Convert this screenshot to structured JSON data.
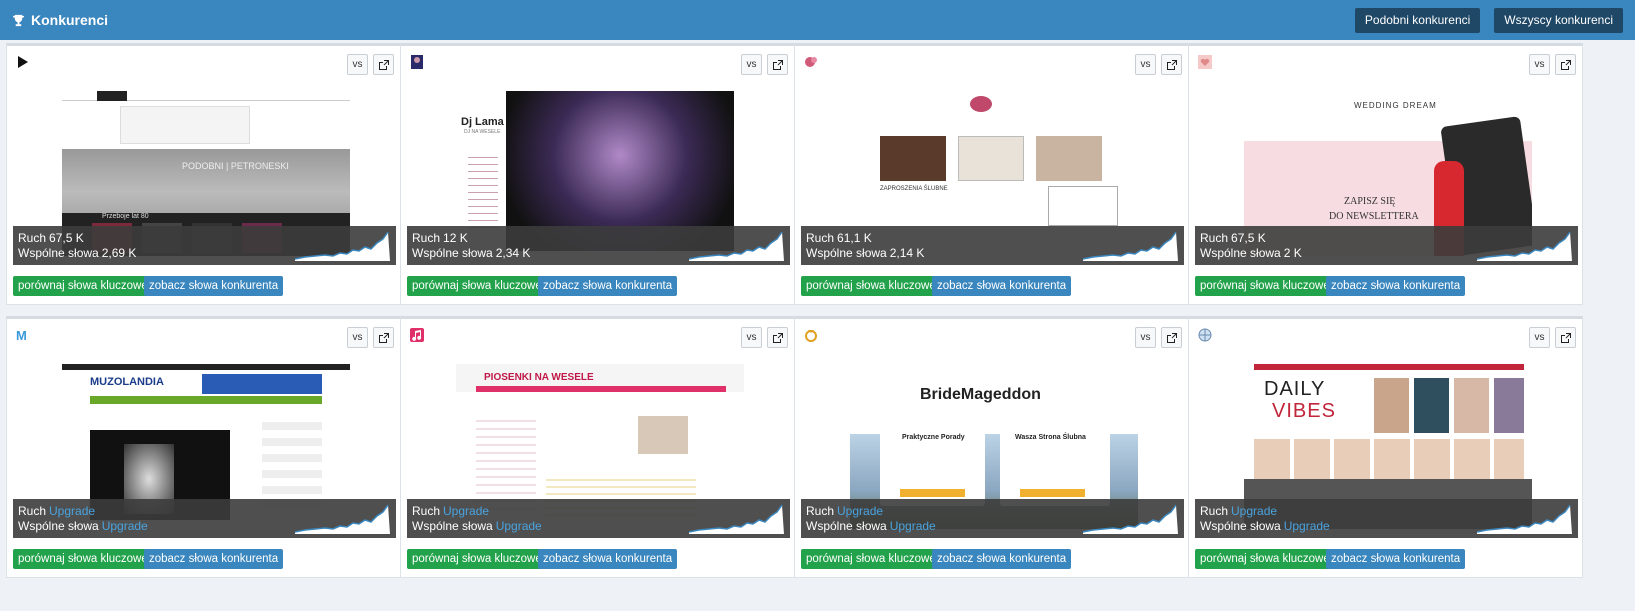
{
  "header": {
    "title": "Konkurenci",
    "btn_similar": "Podobni konkurenci",
    "btn_all": "Wszyscy konkurenci"
  },
  "labels": {
    "traffic": "Ruch",
    "common_words": "Wspólne słowa",
    "vs": "vs",
    "compare": "porównaj słowa kluczowe",
    "see_words": "zobacz słowa konkurenta"
  },
  "cards": [
    {
      "traffic": "67,5 K",
      "common": "2,69 K",
      "thumb_text": [
        "PODOBNI | PETRONESKI",
        "Przeboje lat 80"
      ],
      "favicon": "play-icon"
    },
    {
      "traffic": "12 K",
      "common": "2,34 K",
      "thumb_text": [
        "Dj Lama",
        "DJ NA WESELE"
      ],
      "favicon": "dj-icon"
    },
    {
      "traffic": "61,1 K",
      "common": "2,14 K",
      "thumb_text": [
        "ZAPROSZENIA ŚLUBNE"
      ],
      "favicon": "flower-icon"
    },
    {
      "traffic": "67,5 K",
      "common": "2 K",
      "thumb_text": [
        "WEDDING DREAM",
        "ZAPISZ SIĘ",
        "DO NEWSLETTERA"
      ],
      "favicon": "heart-icon"
    },
    {
      "traffic": "Upgrade",
      "common": "Upgrade",
      "thumb_text": [
        "MUZOLANDIA"
      ],
      "favicon": "m-icon"
    },
    {
      "traffic": "Upgrade",
      "common": "Upgrade",
      "thumb_text": [
        "PIOSENKI NA WESELE"
      ],
      "favicon": "music-icon"
    },
    {
      "traffic": "Upgrade",
      "common": "Upgrade",
      "thumb_text": [
        "BrideMageddon",
        "Praktyczne Porady",
        "Wasza Strona Ślubna"
      ],
      "favicon": "ring-icon"
    },
    {
      "traffic": "Upgrade",
      "common": "Upgrade",
      "thumb_text": [
        "DAILY",
        "VIBES"
      ],
      "favicon": "globe-icon"
    }
  ],
  "colors": {
    "header_bg": "#3a86be",
    "header_btn": "#1f4766",
    "green_btn": "#22a24a",
    "blue_btn": "#3a86be",
    "upgrade": "#4aa3df"
  }
}
